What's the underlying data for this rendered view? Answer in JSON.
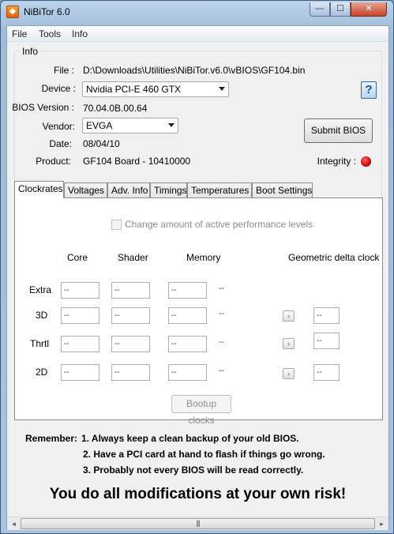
{
  "window": {
    "title": "NiBiTor 6.0",
    "app_icon": "nibitor-app-icon",
    "min_glyph": "—",
    "max_glyph": "☐",
    "close_glyph": "✕"
  },
  "menu": [
    "File",
    "Tools",
    "Info"
  ],
  "info": {
    "group_label": "Info",
    "file_label": "File :",
    "file_value": "D:\\Downloads\\Utilities\\NiBiTor.v6.0\\vBIOS\\GF104.bin",
    "device_label": "Device :",
    "device_value": "Nvidia PCI-E 460 GTX",
    "bios_version_label": "BIOS Version :",
    "bios_version_value": "70.04.0B.00.64",
    "vendor_label": "Vendor:",
    "vendor_value": "EVGA",
    "date_label": "Date:",
    "date_value": "08/04/10",
    "product_label": "Product:",
    "product_value": "GF104 Board - 10410000",
    "integrity_label": "Integrity :",
    "integrity_color": "#d40000",
    "submit_bios": "Submit BIOS",
    "help_glyph": "?"
  },
  "tabs": [
    "Clockrates",
    "Voltages",
    "Adv. Info",
    "Timings",
    "Temperatures",
    "Boot Settings"
  ],
  "active_tab": "Clockrates",
  "clockrates": {
    "checkbox_label": "Change amount of active performance levels",
    "columns": [
      "Core",
      "Shader",
      "Memory",
      "Geometric delta clock"
    ],
    "rows": [
      {
        "label": "Extra",
        "core": "--",
        "shader": "--",
        "memory": "--",
        "extra": "--"
      },
      {
        "label": "3D",
        "core": "--",
        "shader": "--",
        "memory": "--",
        "extra": "--",
        "delta": "--"
      },
      {
        "label": "Thrtl",
        "core": "--",
        "shader": "--",
        "memory": "--",
        "extra": "--",
        "delta": "--"
      },
      {
        "label": "2D",
        "core": "--",
        "shader": "--",
        "memory": "--",
        "extra": "--",
        "delta": "--"
      }
    ],
    "arrow_glyph": "›",
    "bootup_button": "Bootup clocks"
  },
  "remember": {
    "label": "Remember:",
    "lines": [
      "1. Always keep a clean backup of your old BIOS.",
      "2. Have a PCI card at hand to flash if things go wrong.",
      "3. Probably not every BIOS will be read correctly."
    ],
    "warning": "You do all modifications at your own risk!"
  },
  "scrollbar": {
    "left_glyph": "◂",
    "right_glyph": "▸",
    "thumb_grip": "|||"
  }
}
